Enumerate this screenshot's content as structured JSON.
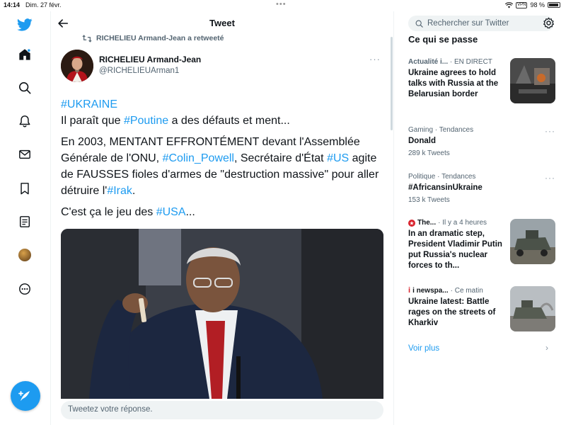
{
  "status_bar": {
    "time": "14:14",
    "date": "Dim. 27 févr.",
    "vpn": "VPN",
    "battery": "98 %"
  },
  "main": {
    "title": "Tweet",
    "retweeted_by": "RICHELIEU Armand-Jean a retweeté",
    "author": {
      "name": "RICHELIEU Armand-Jean",
      "handle": "@RICHELIEUArman1"
    },
    "tweet": {
      "p1_tag": "#UKRAINE",
      "p2_pre": "Il paraît que ",
      "p2_tag": "#Poutine",
      "p2_post": " a des défauts et ment...",
      "p3_pre": "En 2003, MENTANT EFFRONTÉMENT devant l'Assemblée Générale de l'ONU, ",
      "p3_tag1": "#Colin_Powell",
      "p3_mid": ", Secrétaire d'État ",
      "p3_tag2": "#US",
      "p3_mid2": " agite de FAUSSES fioles d'armes de \"destruction massive\" pour aller détruire l'",
      "p3_tag3": "#Irak",
      "p3_post": ".",
      "p4_pre": "C'est ça le jeu des ",
      "p4_tag": "#USA",
      "p4_post": "..."
    },
    "reply_placeholder": "Tweetez votre réponse."
  },
  "sidebar": {
    "search_placeholder": "Rechercher sur Twitter",
    "section_title": "Ce qui se passe",
    "trends": [
      {
        "meta1": "Actualité i...",
        "meta2": "· EN DIRECT",
        "headline": "Ukraine agrees to hold talks with Russia at the Belarusian border",
        "count": ""
      },
      {
        "meta1": "Gaming · Tendances",
        "meta2": "",
        "headline": "Donald",
        "count": "289 k Tweets"
      },
      {
        "meta1": "Politique · Tendances",
        "meta2": "",
        "headline": "#AfricansinUkraine",
        "count": "153 k Tweets"
      },
      {
        "meta1": "The...",
        "meta2": "· Il y a 4 heures",
        "headline": "In an dramatic step, President Vladimir Putin put Russia's nuclear forces to th...",
        "count": ""
      },
      {
        "meta1": "i newspa...",
        "meta2": "· Ce matin",
        "headline": "Ukraine latest: Battle rages on the streets of Kharkiv",
        "count": ""
      }
    ],
    "show_more": "Voir plus"
  },
  "colors": {
    "accent": "#1d9bf0",
    "muted": "#536471",
    "divider": "#eff3f4"
  },
  "icons": {
    "nav": [
      "twitter-logo-icon",
      "home-icon",
      "explore-icon",
      "notifications-icon",
      "messages-icon",
      "bookmarks-icon",
      "lists-icon",
      "profile-avatar",
      "more-icon"
    ],
    "compose": "compose-tweet-icon"
  }
}
